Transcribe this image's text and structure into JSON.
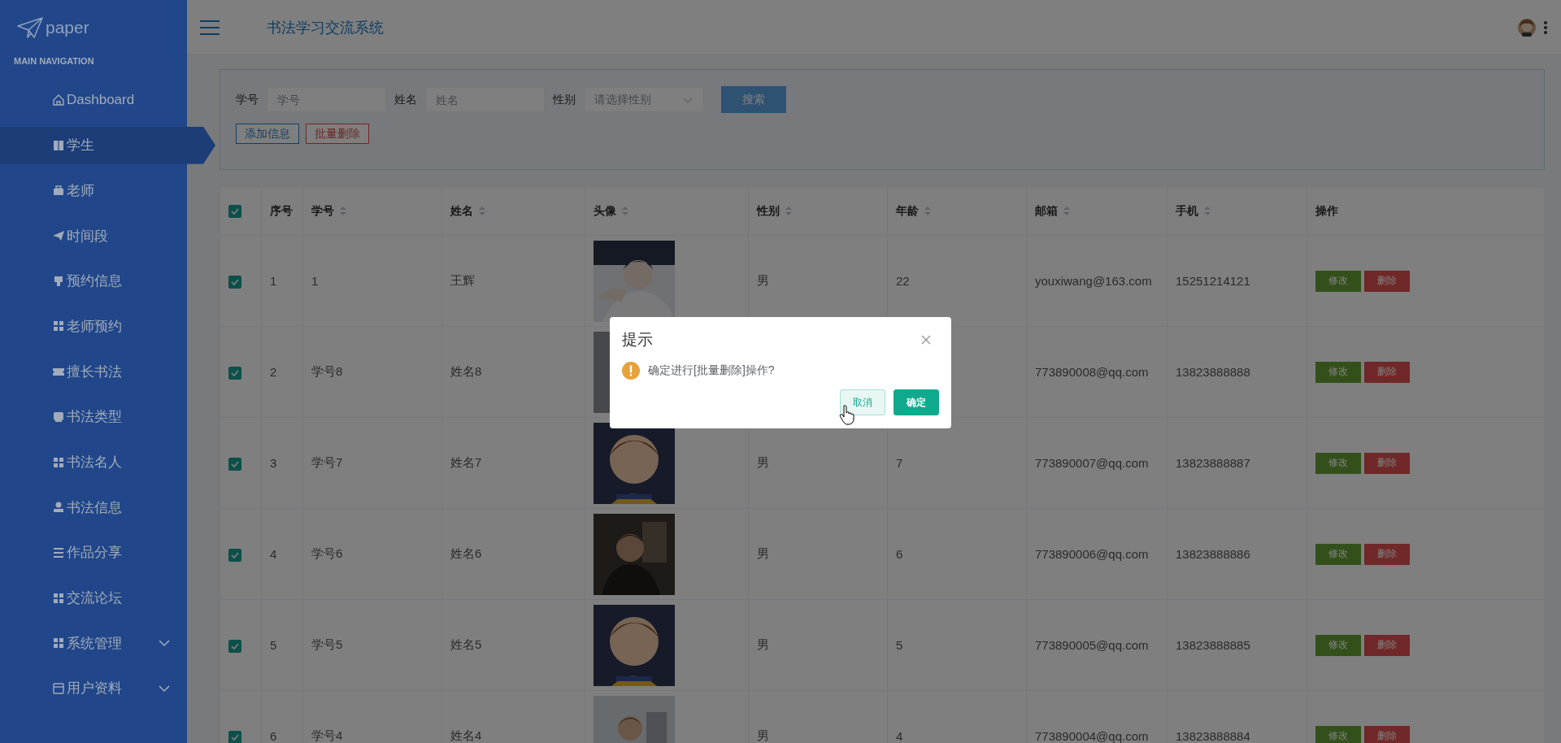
{
  "app": {
    "logo": "paper",
    "title": "书法学习交流系统"
  },
  "sidebar": {
    "heading": "MAIN NAVIGATION",
    "items": [
      {
        "label": "Dashboard",
        "selected": false,
        "kind": "link"
      },
      {
        "label": "学生",
        "selected": true,
        "kind": "link"
      },
      {
        "label": "老师",
        "selected": false,
        "kind": "link"
      },
      {
        "label": "时间段",
        "selected": false,
        "kind": "link"
      },
      {
        "label": "预约信息",
        "selected": false,
        "kind": "link"
      },
      {
        "label": "老师预约",
        "selected": false,
        "kind": "link"
      },
      {
        "label": "擅长书法",
        "selected": false,
        "kind": "link"
      },
      {
        "label": "书法类型",
        "selected": false,
        "kind": "link"
      },
      {
        "label": "书法名人",
        "selected": false,
        "kind": "link"
      },
      {
        "label": "书法信息",
        "selected": false,
        "kind": "link"
      },
      {
        "label": "作品分享",
        "selected": false,
        "kind": "link"
      },
      {
        "label": "交流论坛",
        "selected": false,
        "kind": "link"
      },
      {
        "label": "系统管理",
        "selected": false,
        "kind": "group",
        "expanded": false
      },
      {
        "label": "用户资料",
        "selected": false,
        "kind": "group",
        "expanded": false
      }
    ]
  },
  "search_panel": {
    "fields": [
      {
        "label": "学号",
        "placeholder": "学号",
        "kind": "input"
      },
      {
        "label": "姓名",
        "placeholder": "姓名",
        "kind": "input"
      },
      {
        "label": "性别",
        "placeholder": "请选择性别",
        "kind": "select"
      }
    ],
    "search_button": "搜索",
    "actions": [
      {
        "label": "添加信息",
        "kind": "primary"
      },
      {
        "label": "批量删除",
        "kind": "danger"
      }
    ]
  },
  "table": {
    "select_all": {
      "checked": true
    },
    "columns": [
      {
        "label": "序号",
        "sortable": false
      },
      {
        "label": "学号",
        "sortable": true
      },
      {
        "label": "姓名",
        "sortable": true
      },
      {
        "label": "头像",
        "sortable": true
      },
      {
        "label": "性别",
        "sortable": true
      },
      {
        "label": "年龄",
        "sortable": true
      },
      {
        "label": "邮箱",
        "sortable": true
      },
      {
        "label": "手机",
        "sortable": true
      },
      {
        "label": "操作",
        "sortable": false
      }
    ],
    "rows": [
      {
        "checked": true,
        "index": "1",
        "student_no": "1",
        "name": "王辉",
        "avatar": {
          "kind": "picture"
        },
        "gender": "男",
        "age": "22",
        "email": "youxiwang@163.com",
        "phone": "15251214121",
        "actions": [
          "修改",
          "删除"
        ]
      },
      {
        "checked": true,
        "index": "2",
        "student_no": "学号8",
        "name": "姓名8",
        "avatar": {
          "kind": "picture"
        },
        "email": "773890008@qq.com",
        "phone": "13823888888",
        "actions": [
          "修改",
          "删除"
        ]
      },
      {
        "checked": true,
        "index": "3",
        "student_no": "学号7",
        "name": "姓名7",
        "avatar": {
          "kind": "picture"
        },
        "gender": "男",
        "age": "7",
        "email": "773890007@qq.com",
        "phone": "13823888887",
        "actions": [
          "修改",
          "删除"
        ]
      },
      {
        "checked": true,
        "index": "4",
        "student_no": "学号6",
        "name": "姓名6",
        "avatar": {
          "kind": "picture"
        },
        "gender": "男",
        "age": "6",
        "email": "773890006@qq.com",
        "phone": "13823888886",
        "actions": [
          "修改",
          "删除"
        ]
      },
      {
        "checked": true,
        "index": "5",
        "student_no": "学号5",
        "name": "姓名5",
        "avatar": {
          "kind": "picture"
        },
        "gender": "男",
        "age": "5",
        "email": "773890005@qq.com",
        "phone": "13823888885",
        "actions": [
          "修改",
          "删除"
        ]
      },
      {
        "checked": true,
        "index": "6",
        "student_no": "学号4",
        "name": "姓名4",
        "avatar": {
          "kind": "picture"
        },
        "gender": "男",
        "age": "4",
        "email": "773890004@qq.com",
        "phone": "13823888884",
        "actions": [
          "修改",
          "删除"
        ]
      }
    ]
  },
  "dialog": {
    "title": "提示",
    "message": "确定进行[批量删除]操作?",
    "buttons": [
      {
        "label": "取消",
        "kind": "secondary"
      },
      {
        "label": "确定",
        "kind": "primary"
      }
    ]
  }
}
